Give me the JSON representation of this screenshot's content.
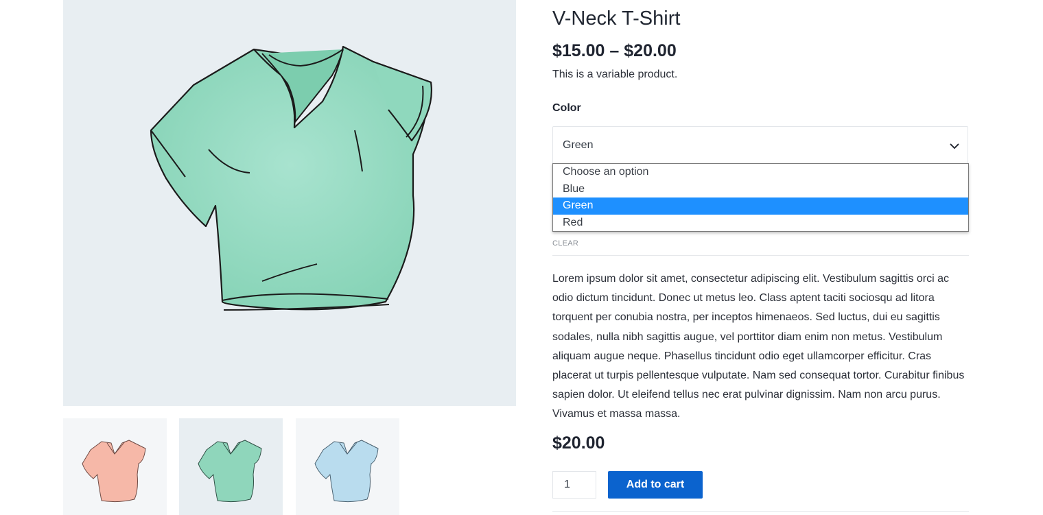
{
  "product": {
    "title": "V-Neck T-Shirt",
    "price_range": "$15.00 – $20.00",
    "short_description": "This is a variable product.",
    "long_description": "Lorem ipsum dolor sit amet, consectetur adipiscing elit. Vestibulum sagittis orci ac odio dictum tincidunt. Donec ut metus leo. Class aptent taciti sociosqu ad litora torquent per conubia nostra, per inceptos himenaeos. Sed luctus, dui eu sagittis sodales, nulla nibh sagittis augue, vel porttitor diam enim non metus. Vestibulum aliquam augue neque. Phasellus tincidunt odio eget ullamcorper efficitur. Cras placerat ut turpis pellentesque vulputate. Nam sed consequat tortor. Curabitur finibus sapien dolor. Ut eleifend tellus nec erat pulvinar dignissim. Nam non arcu purus. Vivamus et massa massa.",
    "variation_price": "$20.00"
  },
  "variations": {
    "attribute_label": "Color",
    "selected_value": "Green",
    "options": [
      "Choose an option",
      "Blue",
      "Green",
      "Red"
    ],
    "clear_label": "CLEAR"
  },
  "cart": {
    "quantity": "1",
    "add_to_cart_label": "Add to cart"
  },
  "gallery": {
    "main_image_icon": "green-vneck-tshirt-image",
    "thumbnails": [
      {
        "icon": "pink-tshirt-thumbnail",
        "color": "#f6b8a8"
      },
      {
        "icon": "green-tshirt-thumbnail",
        "color": "#8fd6bb"
      },
      {
        "icon": "blue-tshirt-thumbnail",
        "color": "#b9dcee"
      }
    ],
    "main_color": "#93dbc2"
  },
  "colors": {
    "accent": "#0b63ce",
    "dropdown_highlight": "#1e90ff",
    "image_background": "#e8eef2"
  }
}
